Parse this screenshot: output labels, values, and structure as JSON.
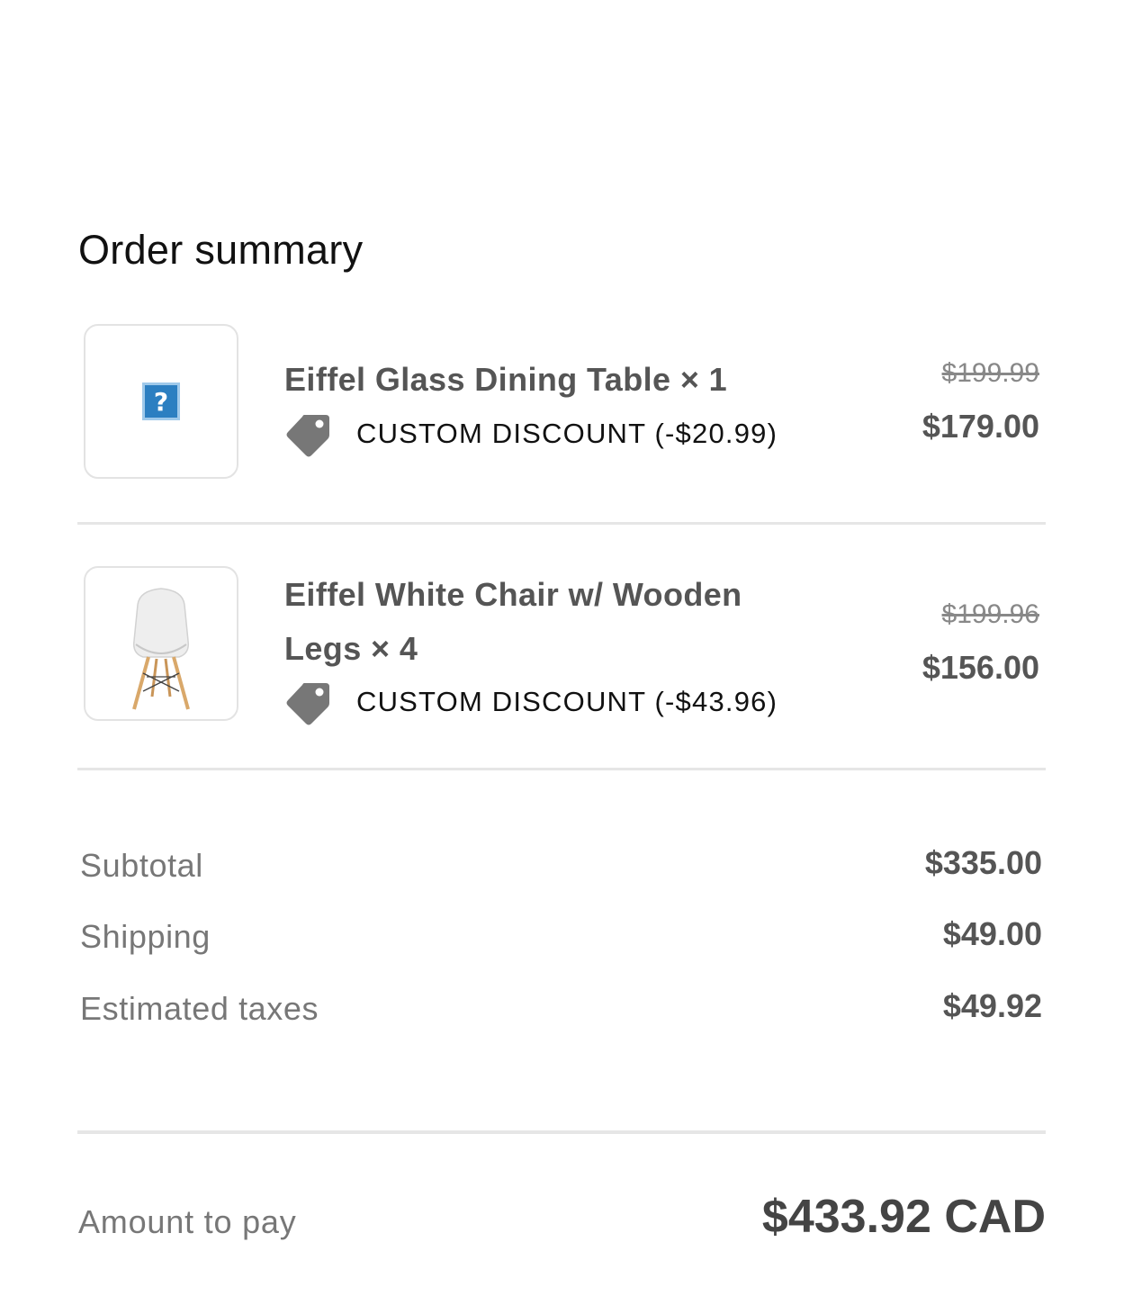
{
  "order": {
    "title": "Order summary",
    "items": [
      {
        "name": "Eiffel Glass Dining Table × 1",
        "discount_label": "CUSTOM DISCOUNT (-$20.99)",
        "original_price": "$199.99",
        "final_price": "$179.00",
        "image_icon": "broken-image-icon"
      },
      {
        "name": "Eiffel White Chair w/ Wooden Legs × 4",
        "discount_label": "CUSTOM DISCOUNT (-$43.96)",
        "original_price": "$199.96",
        "final_price": "$156.00",
        "image_icon": "chair-image"
      }
    ],
    "lines": [
      {
        "label": "Subtotal",
        "value": "$335.00"
      },
      {
        "label": "Shipping",
        "value": "$49.00"
      },
      {
        "label": "Estimated taxes",
        "value": "$49.92"
      }
    ],
    "total": {
      "label": "Amount to pay",
      "value": "$433.92 CAD"
    }
  },
  "colors": {
    "tag_icon": "#777777",
    "divider": "#e6e6e6",
    "broken_image": "#2c7fc1"
  }
}
